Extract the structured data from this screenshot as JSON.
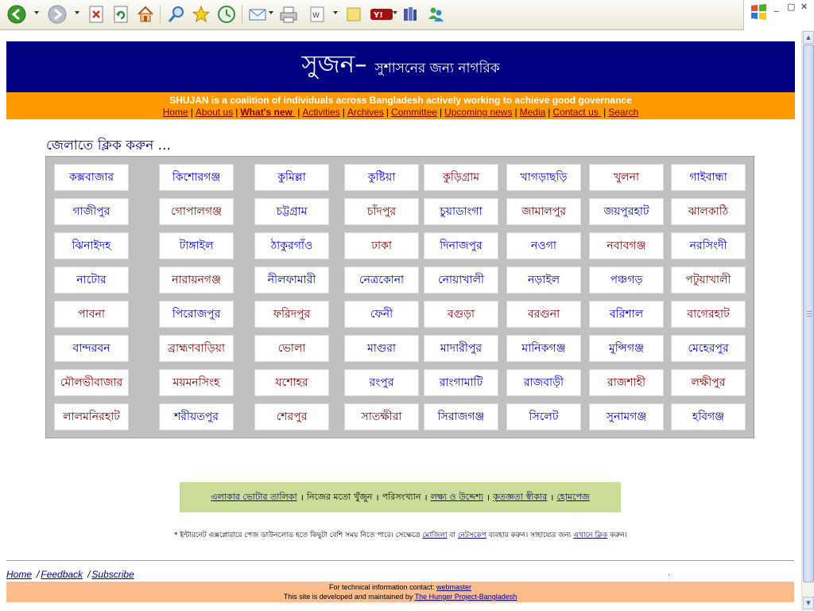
{
  "toolbar": {
    "buttons": [
      {
        "name": "back-button",
        "icon": "back-arrow-icon",
        "color": "#3a9a2a",
        "x_hint": "back"
      },
      {
        "name": "forward-button",
        "icon": "forward-arrow-icon",
        "color": "#9aa0a8"
      },
      {
        "name": "stop-button",
        "icon": "stop-icon",
        "color": "#d03020"
      },
      {
        "name": "refresh-button",
        "icon": "refresh-icon",
        "color": "#2a8a3a"
      },
      {
        "name": "home-button",
        "icon": "home-icon",
        "color": "#c0782a"
      },
      {
        "name": "search-button",
        "icon": "search-icon",
        "color": "#3b6fc0"
      },
      {
        "name": "favorites-button",
        "icon": "star-icon",
        "color": "#e8b814"
      },
      {
        "name": "history-button",
        "icon": "history-icon",
        "color": "#3a8a4a"
      },
      {
        "name": "mail-button",
        "icon": "mail-icon",
        "color": "#4a78b8"
      },
      {
        "name": "print-button",
        "icon": "print-icon",
        "color": "#707070"
      },
      {
        "name": "edit-button",
        "icon": "word-icon",
        "color": "#5a5a5a"
      },
      {
        "name": "notes-button",
        "icon": "note-icon",
        "color": "#f0d050"
      },
      {
        "name": "yahoo-button",
        "icon": "yahoo-icon",
        "color": "#a01010"
      },
      {
        "name": "research-button",
        "icon": "research-icon",
        "color": "#4a5aa0"
      },
      {
        "name": "messenger-button",
        "icon": "messenger-icon",
        "color": "#3a8ac0"
      }
    ]
  },
  "header": {
    "site_name": "সুজন",
    "dash": "–",
    "tagline": "সুশাসনের জন্য নাগরিক",
    "background": "#000080"
  },
  "tagbar": {
    "text": "SHUJAN is a coalition of individuals across Bangladesh actively working to achieve good governance",
    "background": "#ff9900"
  },
  "nav": [
    {
      "label": "Home",
      "bold": false
    },
    {
      "label": "About us",
      "bold": false
    },
    {
      "label": "What's new ",
      "bold": true
    },
    {
      "label": "Activities",
      "bold": false
    },
    {
      "label": "Archives",
      "bold": false
    },
    {
      "label": "Committee",
      "bold": false
    },
    {
      "label": "Upcoming news",
      "bold": false
    },
    {
      "label": "Media",
      "bold": false
    },
    {
      "label": "Contact us ",
      "bold": false
    },
    {
      "label": "Search",
      "bold": false
    }
  ],
  "prompt": "জেলাতে ক্লিক করুন ...",
  "colors": {
    "district_blue": "#0000cc",
    "district_red": "#800000"
  },
  "districts": [
    [
      [
        "কক্সবাজার",
        "b"
      ],
      [
        "কিশোরগঞ্জ",
        "b"
      ],
      [
        "কুমিল্লা",
        "b"
      ],
      [
        "কুষ্টিয়া",
        "b"
      ],
      [
        "কুড়িগ্রাম",
        "r"
      ],
      [
        "খাগড়াছড়ি",
        "b"
      ],
      [
        "খুলনা",
        "r"
      ],
      [
        "গাইবান্ধা",
        "b"
      ]
    ],
    [
      [
        "গাজীপুর",
        "b"
      ],
      [
        "গোপালগঞ্জ",
        "r"
      ],
      [
        "চট্টগ্রাম",
        "b"
      ],
      [
        "চাঁদপুর",
        "r"
      ],
      [
        "চুয়াডাংগা",
        "b"
      ],
      [
        "জামালপুর",
        "r"
      ],
      [
        "জয়পুরহাট",
        "b"
      ],
      [
        "ঝালকাঠি",
        "r"
      ]
    ],
    [
      [
        "ঝিনাইদহ",
        "b"
      ],
      [
        "টাঙ্গাইল",
        "b"
      ],
      [
        "ঠাকুরগাঁও",
        "b"
      ],
      [
        "ঢাকা",
        "r"
      ],
      [
        "দিনাজপুর",
        "b"
      ],
      [
        "নওগা",
        "b"
      ],
      [
        "নবাবগঞ্জ",
        "r"
      ],
      [
        "নরসিংদী",
        "b"
      ]
    ],
    [
      [
        "নাটোর",
        "b"
      ],
      [
        "নারায়নগঞ্জ",
        "r"
      ],
      [
        "নীলফামারী",
        "b"
      ],
      [
        "নেত্রকোনা",
        "b"
      ],
      [
        "নোয়াখালী",
        "b"
      ],
      [
        "নড়াইল",
        "b"
      ],
      [
        "পঞ্চগড়",
        "b"
      ],
      [
        "পটুয়াখালী",
        "r"
      ]
    ],
    [
      [
        "পাবনা",
        "r"
      ],
      [
        "পিরোজপুর",
        "b"
      ],
      [
        "ফরিদপুর",
        "r"
      ],
      [
        "ফেনী",
        "b"
      ],
      [
        "বগুড়া",
        "r"
      ],
      [
        "বরগুনা",
        "r"
      ],
      [
        "বরিশাল",
        "b"
      ],
      [
        "বাগেরহাট",
        "r"
      ]
    ],
    [
      [
        "বান্দরবন",
        "b"
      ],
      [
        "ব্রাহ্মণবাড়িয়া",
        "r"
      ],
      [
        "ভোলা",
        "r"
      ],
      [
        "মাগুরা",
        "b"
      ],
      [
        "মাদারীপুর",
        "b"
      ],
      [
        "মানিকগঞ্জ",
        "b"
      ],
      [
        "মুন্সিগঞ্জ",
        "b"
      ],
      [
        "মেহেরপুর",
        "b"
      ]
    ],
    [
      [
        "মৌলভীবাজার",
        "r"
      ],
      [
        "ময়মনসিংহ",
        "r"
      ],
      [
        "যশোহর",
        "r"
      ],
      [
        "রংপুর",
        "b"
      ],
      [
        "রাংগামাটি",
        "b"
      ],
      [
        "রাজবাড়ী",
        "b"
      ],
      [
        "রাজশাহী",
        "r"
      ],
      [
        "লক্ষীপুর",
        "r"
      ]
    ],
    [
      [
        "লালমনিরহাট",
        "r"
      ],
      [
        "শরীয়তপুর",
        "b"
      ],
      [
        "শেরপুর",
        "r"
      ],
      [
        "সাতক্ষীরা",
        "r"
      ],
      [
        "সিরাজগঞ্জ",
        "b"
      ],
      [
        "সিলেট",
        "b"
      ],
      [
        "সুনামগঞ্জ",
        "b"
      ],
      [
        "হবিগঞ্জ",
        "b"
      ]
    ]
  ],
  "footer_links": {
    "items": [
      {
        "label": "এলাকার ভোটার তালিকা",
        "link": true
      },
      {
        "label": "নিজের মতো খুঁজুন",
        "link": false
      },
      {
        "label": "পরিসংখ্যান",
        "link": false
      },
      {
        "label": "লক্ষ্য ও উদ্দেশ্য",
        "link": true
      },
      {
        "label": "কৃতজ্ঞতা স্বীকার",
        "link": true
      },
      {
        "label": "হোমপেজ",
        "link": true
      }
    ],
    "separator": "।",
    "background": "#ccdd99"
  },
  "note": {
    "part1": "* ইন্টারনেট এক্সপ্লোরারে পেজ ডাউনলোড হতে কিছুটা বেশি সময় নিতে পারে। সেক্ষেত্রে ",
    "link1": "মোজিলা",
    "part2": " বা ",
    "link2": "নেটসকেপ",
    "part3": " ব্যবহার করুন। সাহায্যের জন্য ",
    "link3": "এখানে ক্লিক",
    "part4": " করুন।"
  },
  "bottom_nav": [
    {
      "label": "Home"
    },
    {
      "label": "Feedback"
    },
    {
      "label": "Subscribe"
    }
  ],
  "bottom_sep": "/",
  "credits": {
    "line1_prefix": "For technical information contact: ",
    "line1_link": "webmaster",
    "line2_prefix": "This site is developed and maintained by ",
    "line2_link": "The Hunger Project-Bangladesh",
    "background": "#fcbc8c"
  },
  "dot": "."
}
